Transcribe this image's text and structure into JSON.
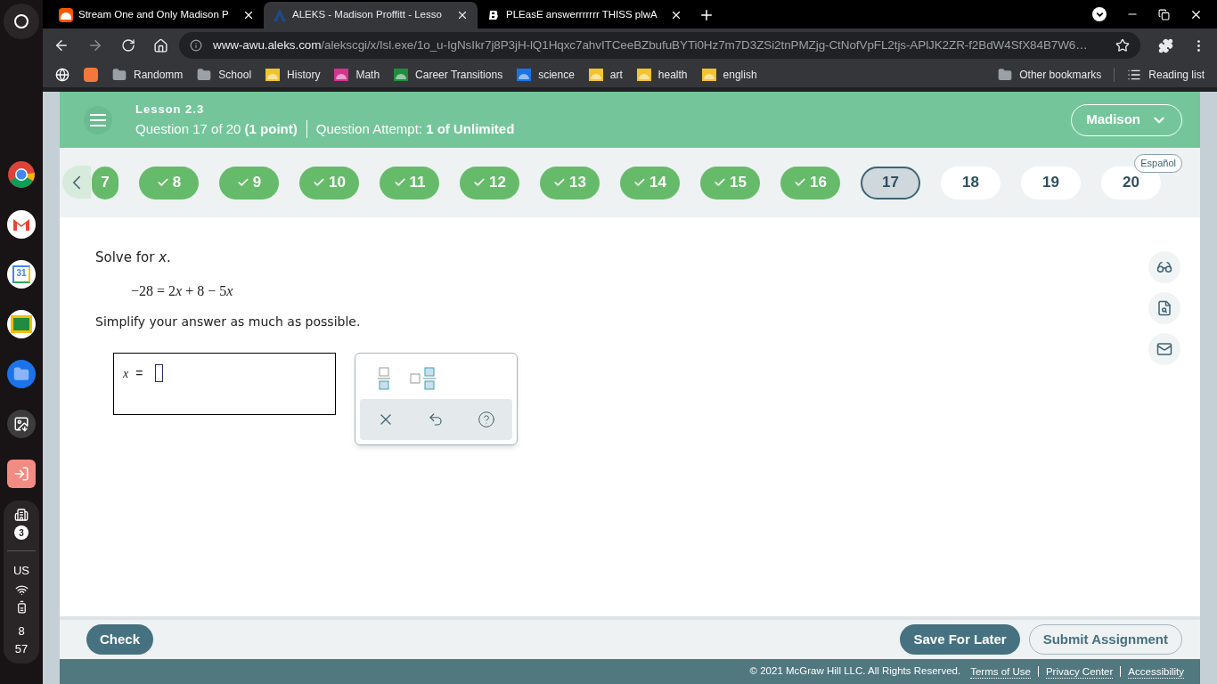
{
  "shelf": {
    "apps": [
      {
        "kind": "chrome"
      },
      {
        "kind": "gmail"
      },
      {
        "kind": "calendar",
        "label": "31"
      },
      {
        "kind": "classroom"
      },
      {
        "kind": "files"
      },
      {
        "kind": "screenshot"
      },
      {
        "kind": "exit"
      }
    ],
    "status": {
      "notifications": "3",
      "keyboard": "US",
      "hour": "8",
      "minute": "57"
    }
  },
  "browser": {
    "tabs": [
      {
        "title": "Stream One and Only Madison P",
        "kind": "soundcloud",
        "selected": false
      },
      {
        "title": "ALEKS - Madison Proffitt - Lesso",
        "kind": "aleks",
        "selected": true
      },
      {
        "title": "PLEasE answerrrrrrr THISS plwA",
        "kind": "brainly",
        "selected": false
      }
    ],
    "url": {
      "host": "www-awu.aleks.com",
      "path": "/alekscgi/x/Isl.exe/1o_u-IgNsIkr7j8P3jH-lQ1Hqxc7ahvITCeeBZbufuBYTi0Hz7m7D3ZSi2tnPMZjg-CtNofVpFL2tjs-APlJK2ZR-f2BdW4SfX84B7W6…"
    },
    "bookmarks": [
      {
        "kind": "globe"
      },
      {
        "kind": "app",
        "color": "#f4783c"
      },
      {
        "kind": "folder",
        "label": "Randomm"
      },
      {
        "kind": "folder",
        "label": "School"
      },
      {
        "kind": "classroom",
        "label": "History",
        "color": "#f2c42b"
      },
      {
        "kind": "classroom",
        "label": "Math",
        "color": "#d6338f"
      },
      {
        "kind": "classroom",
        "label": "Career Transitions",
        "color": "#1e8e3e"
      },
      {
        "kind": "classroom",
        "label": "science",
        "color": "#1a73e8"
      },
      {
        "kind": "classroom",
        "label": "art",
        "color": "#f2c42b"
      },
      {
        "kind": "classroom",
        "label": "health",
        "color": "#f2c42b"
      },
      {
        "kind": "classroom",
        "label": "english",
        "color": "#f2c42b"
      }
    ],
    "other_bookmarks": "Other bookmarks",
    "reading_list": "Reading list"
  },
  "aleks": {
    "header": {
      "lesson": "Lesson 2.3",
      "question": "Question 17 of 20",
      "points": "(1 point)",
      "attempt_label": "Question Attempt:",
      "attempt_value": "1 of Unlimited",
      "user": "Madison"
    },
    "language": "Español",
    "questions": [
      {
        "number": "7",
        "completed": true,
        "selected": false
      },
      {
        "number": "8",
        "completed": true,
        "selected": false
      },
      {
        "number": "9",
        "completed": true,
        "selected": false
      },
      {
        "number": "10",
        "completed": true,
        "selected": false
      },
      {
        "number": "11",
        "completed": true,
        "selected": false
      },
      {
        "number": "12",
        "completed": true,
        "selected": false
      },
      {
        "number": "13",
        "completed": true,
        "selected": false
      },
      {
        "number": "14",
        "completed": true,
        "selected": false
      },
      {
        "number": "15",
        "completed": true,
        "selected": false
      },
      {
        "number": "16",
        "completed": true,
        "selected": false
      },
      {
        "number": "17",
        "completed": false,
        "selected": true
      },
      {
        "number": "18",
        "completed": false,
        "selected": false
      },
      {
        "number": "19",
        "completed": false,
        "selected": false
      },
      {
        "number": "20",
        "completed": false,
        "selected": false
      }
    ],
    "problem": {
      "prompt": "Solve for *x*.",
      "equation": [
        "−28 = 2",
        "*x*",
        " + 8 − 5",
        "*x*"
      ],
      "instruction": "Simplify your answer as much as possible."
    },
    "answer": {
      "variable": "x",
      "equals": "="
    },
    "buttons": {
      "check": "Check",
      "save": "Save For Later",
      "submit": "Submit Assignment"
    },
    "footer": {
      "copyright": "© 2021 McGraw Hill LLC. All Rights Reserved.",
      "links": [
        "Terms of Use",
        "Privacy Center",
        "Accessibility"
      ]
    }
  }
}
